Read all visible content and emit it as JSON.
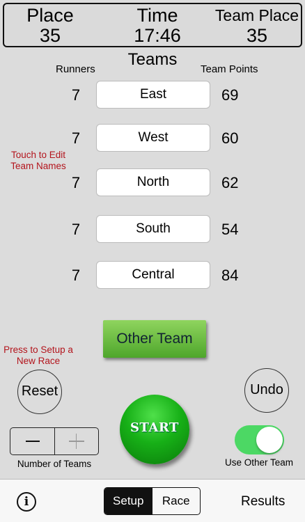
{
  "scoreboard": {
    "place_label": "Place",
    "place_value": "35",
    "time_label": "Time",
    "time_value": "17:46",
    "team_place_label": "Team Place",
    "team_place_value": "35"
  },
  "teams_title": "Teams",
  "runners_header": "Runners",
  "points_header": "Team Points",
  "teams": [
    {
      "runners": "7",
      "name": "East",
      "points": "69"
    },
    {
      "runners": "7",
      "name": "West",
      "points": "60"
    },
    {
      "runners": "7",
      "name": "North",
      "points": "62"
    },
    {
      "runners": "7",
      "name": "South",
      "points": "54"
    },
    {
      "runners": "7",
      "name": "Central",
      "points": "84"
    }
  ],
  "hint_edit": "Touch to Edit Team Names",
  "other_team_label": "Other Team",
  "hint_reset": "Press to Setup a New Race",
  "reset_label": "Reset",
  "undo_label": "Undo",
  "start_label": "START",
  "stepper_label": "Number of Teams",
  "toggle": {
    "label": "Use Other Team",
    "on": true
  },
  "tabbar": {
    "info_icon": "i",
    "setup_label": "Setup",
    "race_label": "Race",
    "results_label": "Results"
  },
  "colors": {
    "accent_green": "#4cd864",
    "hint_red": "#b3141c",
    "start_green": "#17b017"
  }
}
